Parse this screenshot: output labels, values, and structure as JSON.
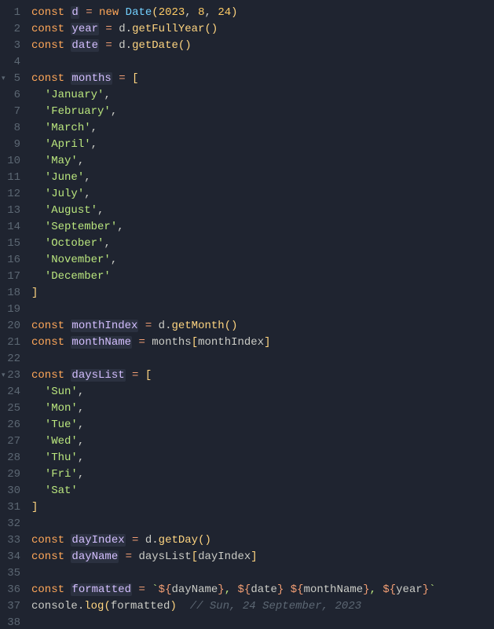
{
  "lines": [
    {
      "n": 1,
      "fold": false
    },
    {
      "n": 2,
      "fold": false
    },
    {
      "n": 3,
      "fold": false
    },
    {
      "n": 4,
      "fold": false
    },
    {
      "n": 5,
      "fold": true
    },
    {
      "n": 6,
      "fold": false
    },
    {
      "n": 7,
      "fold": false
    },
    {
      "n": 8,
      "fold": false
    },
    {
      "n": 9,
      "fold": false
    },
    {
      "n": 10,
      "fold": false
    },
    {
      "n": 11,
      "fold": false
    },
    {
      "n": 12,
      "fold": false
    },
    {
      "n": 13,
      "fold": false
    },
    {
      "n": 14,
      "fold": false
    },
    {
      "n": 15,
      "fold": false
    },
    {
      "n": 16,
      "fold": false
    },
    {
      "n": 17,
      "fold": false
    },
    {
      "n": 18,
      "fold": false
    },
    {
      "n": 19,
      "fold": false
    },
    {
      "n": 20,
      "fold": false
    },
    {
      "n": 21,
      "fold": false
    },
    {
      "n": 22,
      "fold": false
    },
    {
      "n": 23,
      "fold": true
    },
    {
      "n": 24,
      "fold": false
    },
    {
      "n": 25,
      "fold": false
    },
    {
      "n": 26,
      "fold": false
    },
    {
      "n": 27,
      "fold": false
    },
    {
      "n": 28,
      "fold": false
    },
    {
      "n": 29,
      "fold": false
    },
    {
      "n": 30,
      "fold": false
    },
    {
      "n": 31,
      "fold": false
    },
    {
      "n": 32,
      "fold": false
    },
    {
      "n": 33,
      "fold": false
    },
    {
      "n": 34,
      "fold": false
    },
    {
      "n": 35,
      "fold": false
    },
    {
      "n": 36,
      "fold": false
    },
    {
      "n": 37,
      "fold": false
    },
    {
      "n": 38,
      "fold": false
    }
  ],
  "tok": {
    "const": "const",
    "new": "new",
    "Date": "Date",
    "d": "d",
    "year": "year",
    "date": "date",
    "months": "months",
    "monthIndex": "monthIndex",
    "monthName": "monthName",
    "daysList": "daysList",
    "dayIndex": "dayIndex",
    "dayName": "dayName",
    "formatted": "formatted",
    "getFullYear": "getFullYear",
    "getDate": "getDate",
    "getMonth": "getMonth",
    "getDay": "getDay",
    "console": "console",
    "log": "log",
    "n2023": "2023",
    "n8": "8",
    "n24": "24",
    "jan": "'January'",
    "feb": "'February'",
    "mar": "'March'",
    "apr": "'April'",
    "may": "'May'",
    "jun": "'June'",
    "jul": "'July'",
    "aug": "'August'",
    "sep": "'September'",
    "oct": "'October'",
    "nov": "'November'",
    "dec": "'December'",
    "sun": "'Sun'",
    "mon": "'Mon'",
    "tue": "'Tue'",
    "wed": "'Wed'",
    "thu": "'Thu'",
    "fri": "'Fri'",
    "sat": "'Sat'",
    "eq": " = ",
    "dot": ".",
    "comma": ", ",
    "comma_nl": ",",
    "lparen": "(",
    "rparen": ")",
    "lbracket": "[",
    "rbracket": "]",
    "backtick": "`",
    "dollar_open": "${",
    "close_brace": "}",
    "comment": "// Sun, 24 September, 2023"
  }
}
